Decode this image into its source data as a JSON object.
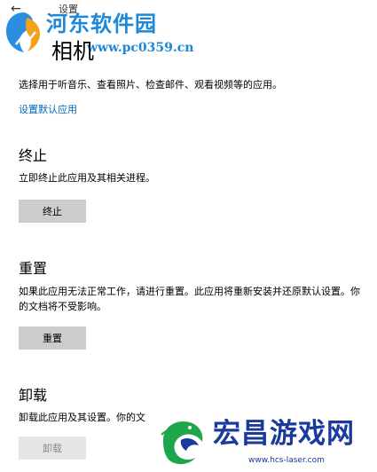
{
  "window": {
    "title": "设置",
    "back_icon": "back-arrow-icon"
  },
  "watermark_top": {
    "name": "河东软件园",
    "url": "www.pc0359.cn"
  },
  "app": {
    "title": "相机",
    "description": "选择用于听音乐、查看照片、检查邮件、观看视频等的应用。",
    "default_apps_link": "设置默认应用"
  },
  "terminate": {
    "heading": "终止",
    "text": "立即终止此应用及其相关进程。",
    "button": "终止"
  },
  "reset": {
    "heading": "重置",
    "text": "如果此应用无法正常工作，请进行重置。此应用将重新安装并还原默认设置。你的文档将不受影响。",
    "button": "重置"
  },
  "uninstall": {
    "heading": "卸载",
    "text": "卸载此应用及其设置。你的文",
    "button": "卸载"
  },
  "watermark_bottom": {
    "name": "宏昌游戏网",
    "url": "www.hcs-laser.com"
  },
  "colors": {
    "accent_link": "#0067b8",
    "button_bg": "#cccccc",
    "button_disabled_bg": "#e6e6e6",
    "watermark_top": "#1e88d8",
    "watermark_bottom": "#1a3a9e"
  }
}
